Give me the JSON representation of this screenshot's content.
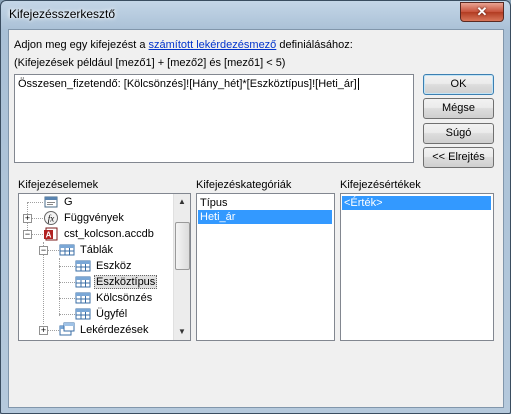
{
  "window": {
    "title": "Kifejezésszerkesztő",
    "close_glyph": "✕"
  },
  "description": {
    "prefix": "Adjon meg egy kifejezést a ",
    "link": "számított lekérdezésmező",
    "suffix": " definiálásához:",
    "example": "(Kifejezések például [mező1] + [mező2] és [mező1] < 5)"
  },
  "expression": {
    "value": "Összesen_fizetendő: [Kölcsönzés]![Hány_hét]*[Eszköztípus]![Heti_ár]"
  },
  "buttons": {
    "ok": "OK",
    "cancel": "Mégse",
    "help": "Súgó",
    "less": "<< Elrejtés"
  },
  "panels": {
    "elements_label": "Kifejezéselemek",
    "categories_label": "Kifejezéskategóriák",
    "values_label": "Kifejezésértékek"
  },
  "tree": [
    {
      "label": "G",
      "icon": "form-icon"
    },
    {
      "label": "Függvények",
      "icon": "function-icon",
      "expander": "+"
    },
    {
      "label": "cst_kolcson.accdb",
      "icon": "access-db-icon",
      "expander": "−"
    },
    {
      "label": "Táblák",
      "icon": "tables-icon",
      "expander": "−"
    },
    {
      "label": "Eszköz",
      "icon": "table-icon"
    },
    {
      "label": "Eszköztípus",
      "icon": "table-icon",
      "selected": true
    },
    {
      "label": "Kölcsönzés",
      "icon": "table-icon"
    },
    {
      "label": "Ügyfél",
      "icon": "table-icon"
    },
    {
      "label": "Lekérdezések",
      "icon": "queries-icon",
      "expander": "+"
    }
  ],
  "categories": [
    {
      "label": "Típus",
      "selected": false
    },
    {
      "label": "Heti_ár",
      "selected": true
    }
  ],
  "values": [
    {
      "label": "<Érték>",
      "selected": true
    }
  ],
  "colors": {
    "selection": "#3399ff",
    "link": "#0033cc",
    "close_button": "#c7513a"
  }
}
